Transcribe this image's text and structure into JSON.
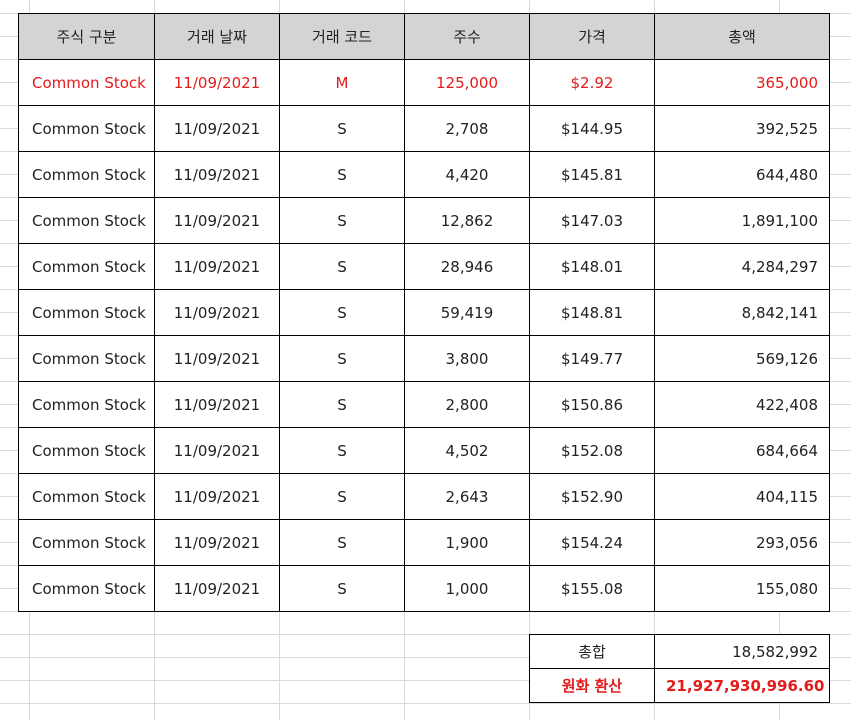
{
  "table": {
    "headers": [
      "주식 구분",
      "거래 날짜",
      "거래 코드",
      "주수",
      "가격",
      "총액"
    ],
    "rows": [
      {
        "type": "Common Stock",
        "date": "11/09/2021",
        "code": "M",
        "shares": "125,000",
        "price": "$2.92",
        "total": "365,000",
        "highlight": true
      },
      {
        "type": "Common Stock",
        "date": "11/09/2021",
        "code": "S",
        "shares": "2,708",
        "price": "$144.95",
        "total": "392,525"
      },
      {
        "type": "Common Stock",
        "date": "11/09/2021",
        "code": "S",
        "shares": "4,420",
        "price": "$145.81",
        "total": "644,480"
      },
      {
        "type": "Common Stock",
        "date": "11/09/2021",
        "code": "S",
        "shares": "12,862",
        "price": "$147.03",
        "total": "1,891,100"
      },
      {
        "type": "Common Stock",
        "date": "11/09/2021",
        "code": "S",
        "shares": "28,946",
        "price": "$148.01",
        "total": "4,284,297"
      },
      {
        "type": "Common Stock",
        "date": "11/09/2021",
        "code": "S",
        "shares": "59,419",
        "price": "$148.81",
        "total": "8,842,141"
      },
      {
        "type": "Common Stock",
        "date": "11/09/2021",
        "code": "S",
        "shares": "3,800",
        "price": "$149.77",
        "total": "569,126"
      },
      {
        "type": "Common Stock",
        "date": "11/09/2021",
        "code": "S",
        "shares": "2,800",
        "price": "$150.86",
        "total": "422,408"
      },
      {
        "type": "Common Stock",
        "date": "11/09/2021",
        "code": "S",
        "shares": "4,502",
        "price": "$152.08",
        "total": "684,664"
      },
      {
        "type": "Common Stock",
        "date": "11/09/2021",
        "code": "S",
        "shares": "2,643",
        "price": "$152.90",
        "total": "404,115"
      },
      {
        "type": "Common Stock",
        "date": "11/09/2021",
        "code": "S",
        "shares": "1,900",
        "price": "$154.24",
        "total": "293,056"
      },
      {
        "type": "Common Stock",
        "date": "11/09/2021",
        "code": "S",
        "shares": "1,000",
        "price": "$155.08",
        "total": "155,080"
      }
    ]
  },
  "summary": {
    "total_label": "총합",
    "total_value": "18,582,992",
    "krw_label": "원화 환산",
    "krw_value": "21,927,930,996.60"
  },
  "colors": {
    "highlight": "#e31b1b",
    "header_bg": "#d4d4d4",
    "grid": "#d9d9d9"
  }
}
